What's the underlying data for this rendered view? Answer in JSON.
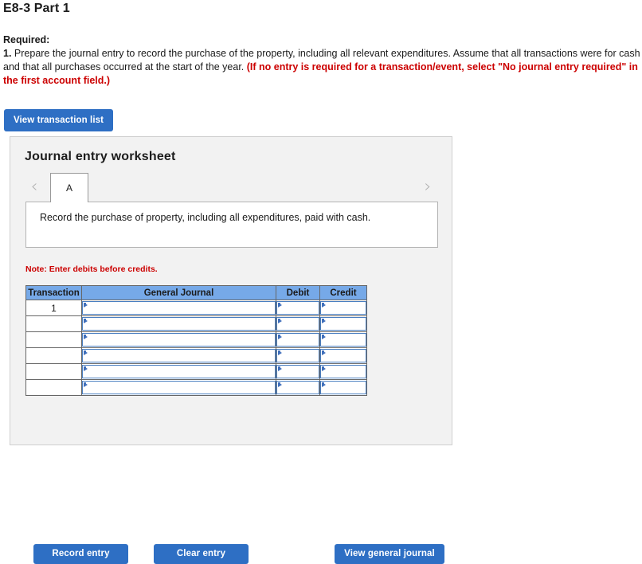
{
  "page": {
    "title": "E8-3 Part 1"
  },
  "required": {
    "label": "Required:",
    "number": "1.",
    "text_part1": " Prepare the journal entry to record the purchase of the property, including all relevant expenditures. Assume that all transactions were for cash and that all purchases occurred at the start of the year. ",
    "text_highlight": "(If no entry is required for a transaction/event, select \"No journal entry required\" in the first account field.)"
  },
  "toolbar": {
    "view_transaction_list_label": "View transaction list"
  },
  "worksheet": {
    "title": "Journal entry worksheet",
    "prev_icon": "‹",
    "next_icon": "›",
    "tabs": [
      {
        "label": "A",
        "active": true
      }
    ],
    "description": "Record the purchase of property, including all expenditures, paid with cash.",
    "note": "Note: Enter debits before credits.",
    "table": {
      "headers": [
        "Transaction",
        "General Journal",
        "Debit",
        "Credit"
      ],
      "rows": [
        {
          "transaction": "1",
          "general_journal": "",
          "debit": "",
          "credit": ""
        },
        {
          "transaction": "",
          "general_journal": "",
          "debit": "",
          "credit": ""
        },
        {
          "transaction": "",
          "general_journal": "",
          "debit": "",
          "credit": ""
        },
        {
          "transaction": "",
          "general_journal": "",
          "debit": "",
          "credit": ""
        },
        {
          "transaction": "",
          "general_journal": "",
          "debit": "",
          "credit": ""
        },
        {
          "transaction": "",
          "general_journal": "",
          "debit": "",
          "credit": ""
        }
      ]
    },
    "buttons": {
      "record_entry": "Record entry",
      "clear_entry": "Clear entry",
      "view_general_journal": "View general journal"
    }
  },
  "colors": {
    "button_blue": "#2e6fc4",
    "table_header_blue": "#76a9e8",
    "panel_gray": "#f2f2f2",
    "note_red": "#cc0000",
    "input_border_blue": "#4a7fc1"
  }
}
